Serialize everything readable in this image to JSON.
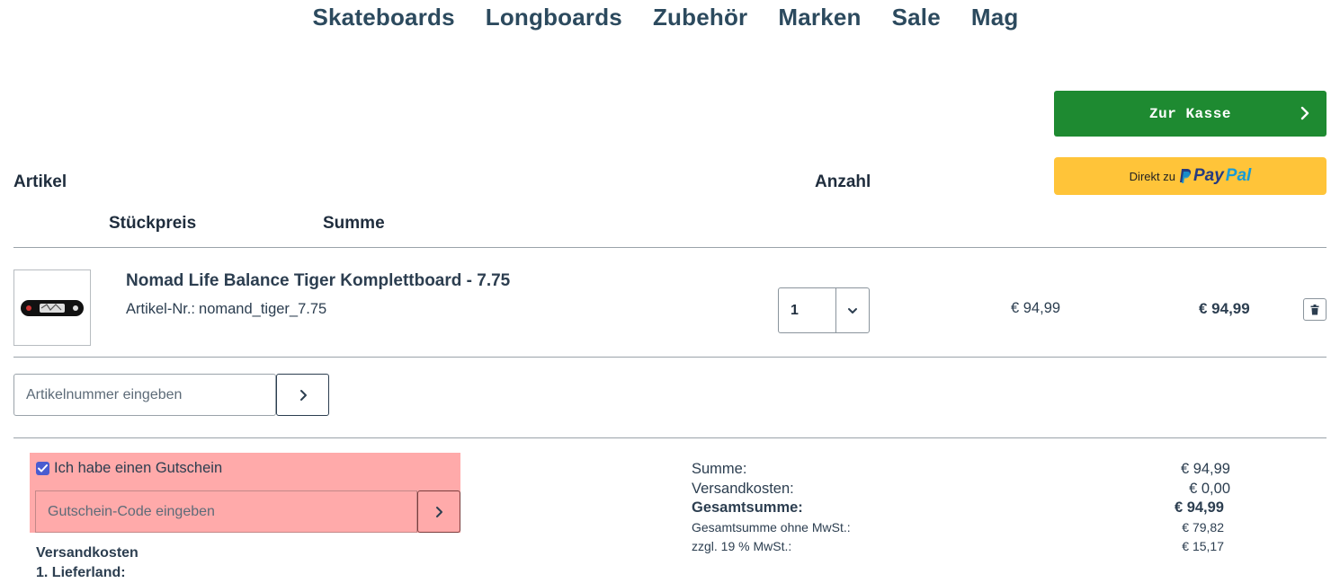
{
  "nav": {
    "items": [
      "Skateboards",
      "Longboards",
      "Zubehör",
      "Marken",
      "Sale",
      "Mag"
    ]
  },
  "checkout": {
    "kasse_label": "Zur Kasse",
    "paypal_prefix": "Direkt zu",
    "paypal_brand_1": "Pay",
    "paypal_brand_2": "Pal"
  },
  "table_headers": {
    "artikel": "Artikel",
    "anzahl": "Anzahl",
    "stueckpreis": "Stückpreis",
    "summe": "Summe"
  },
  "cart_item": {
    "title": "Nomad Life Balance Tiger Komplettboard - 7.75",
    "sku_label": "Artikel-Nr.:",
    "sku": "nomand_tiger_7.75",
    "quantity": "1",
    "unit_price": "€ 94,99",
    "total_price": "€ 94,99"
  },
  "sku_entry": {
    "placeholder": "Artikelnummer eingeben"
  },
  "voucher": {
    "checkbox_label": "Ich habe einen Gutschein",
    "checked": true,
    "placeholder": "Gutschein-Code eingeben"
  },
  "shipping": {
    "title": "Versandkosten",
    "country_label": "1. Lieferland:"
  },
  "summary": {
    "rows": [
      {
        "label": "Summe:",
        "value": "€ 94,99"
      },
      {
        "label": "Versandkosten:",
        "value": "€ 0,00"
      },
      {
        "label": "Gesamtsumme:",
        "value": "€ 94,99"
      },
      {
        "label": "Gesamtsumme ohne MwSt.:",
        "value": "€ 79,82"
      },
      {
        "label": "zzgl. 19 % MwSt.:",
        "value": "€ 15,17"
      }
    ]
  },
  "colors": {
    "checkout_green": "#1e8a31",
    "paypal_yellow": "#ffc439",
    "voucher_highlight": "#ffaaaa",
    "text_dark": "#2c3e50"
  }
}
